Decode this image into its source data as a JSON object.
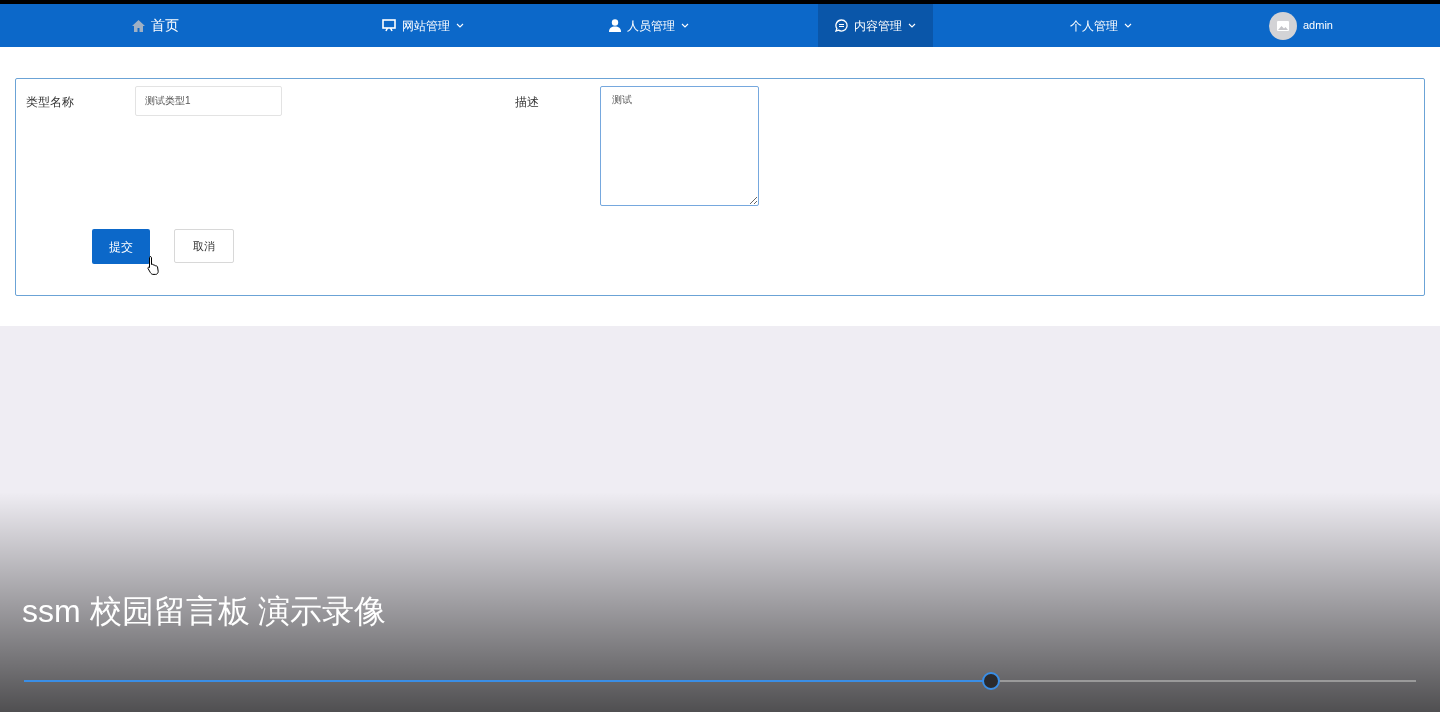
{
  "nav": {
    "items": [
      {
        "label": "首页",
        "dropdown": false,
        "selected": false
      },
      {
        "label": "网站管理",
        "dropdown": true,
        "selected": false
      },
      {
        "label": "人员管理",
        "dropdown": true,
        "selected": false
      },
      {
        "label": "内容管理",
        "dropdown": true,
        "selected": true
      },
      {
        "label": "个人管理",
        "dropdown": true,
        "selected": false
      }
    ],
    "user": {
      "name": "admin"
    }
  },
  "form": {
    "fields": [
      {
        "label": "类型名称",
        "kind": "input",
        "value": "测试类型1"
      },
      {
        "label": "描述",
        "kind": "textarea",
        "value": "测试"
      }
    ],
    "buttons": [
      {
        "label": "提交",
        "kind": "primary"
      },
      {
        "label": "取消",
        "kind": "default"
      }
    ]
  },
  "video": {
    "title": "ssm 校园留言板 演示录像",
    "progress": {
      "level": 0.695
    }
  }
}
